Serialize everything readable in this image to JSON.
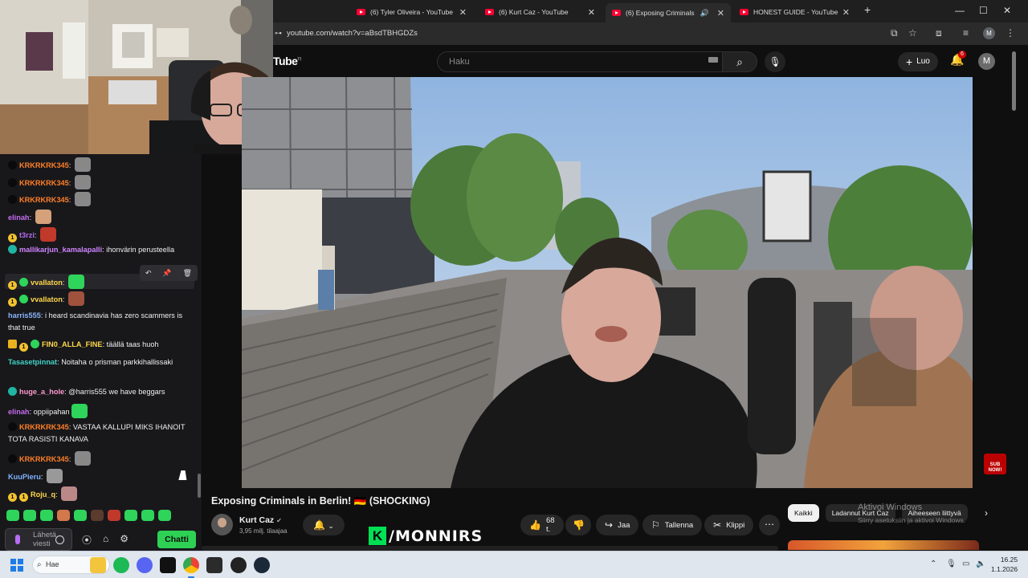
{
  "browser": {
    "tabs": [
      {
        "title": "(6) Tyler Oliveira - YouTube",
        "active": false
      },
      {
        "title": "(6) Kurt Caz - YouTube",
        "active": false
      },
      {
        "title": "(6) Exposing Criminals in Be",
        "active": true
      },
      {
        "title": "HONEST GUIDE - YouTube",
        "active": false
      }
    ],
    "new_tab": "+",
    "url": "youtube.com/watch?v=aBsdTBHGDZs",
    "profile_initial": "M"
  },
  "youtube": {
    "logo": "Tube",
    "region": "FI",
    "search_placeholder": "Haku",
    "create_label": "Luo",
    "notification_count": "6",
    "avatar_initial": "M",
    "video_title": "Exposing Criminals in Berlin! 🇩🇪 (SHOCKING)",
    "channel_name": "Kurt Caz",
    "subscribers": "3,95 milj. tilaajaa",
    "likes": "68 t.",
    "share_label": "Jaa",
    "save_label": "Tallenna",
    "clip_label": "Klippi",
    "chips": [
      "Kaikki",
      "Ladannut Kurt Caz",
      "Aiheeseen liittyvä"
    ],
    "sub_badge": "SUB NOW!"
  },
  "overlay": {
    "brand_letter": "K",
    "brand_text": "/MONNIRS",
    "windows_activate_title": "Aktivoi Windows",
    "windows_activate_sub": "Siirry asetuksiin ja aktivoi Windows."
  },
  "chat": {
    "messages": [
      {
        "user": "KRKRKRK345",
        "color": "#ff7f27",
        "badges": [
          "dark"
        ],
        "text": "",
        "emote": "#888"
      },
      {
        "user": "KRKRKRK345",
        "color": "#ff7f27",
        "badges": [
          "dark"
        ],
        "text": "",
        "emote": "#888"
      },
      {
        "user": "KRKRKRK345",
        "color": "#ff7f27",
        "badges": [
          "dark"
        ],
        "text": "",
        "emote": "#888"
      },
      {
        "user": "elinah",
        "color": "#c56bf0",
        "badges": [],
        "text": "",
        "emote": "#d4a17a"
      },
      {
        "user": "t3rzi",
        "color": "#b66bf0",
        "badges": [
          "gold"
        ],
        "text": "",
        "emote": "#c0392b"
      },
      {
        "user": "mallikarjun_kamalapalli",
        "color": "#d084ff",
        "badges": [
          "tea"
        ],
        "text": "ihonvärin perusteella",
        "emote": ""
      },
      {
        "user": "vvallaton",
        "color": "#ffd84a",
        "badges": [
          "gold",
          "green"
        ],
        "text": "",
        "emote": "#2fd45a"
      },
      {
        "user": "vvallaton",
        "color": "#ffd84a",
        "badges": [
          "gold",
          "green"
        ],
        "text": "",
        "emote": "#a0523d"
      },
      {
        "user": "harris555",
        "color": "#8bb4ff",
        "badges": [],
        "text": "i heard scandinavia has zero scammers is that true",
        "emote": ""
      },
      {
        "user": "FIN0_ALLA_FINE",
        "color": "#ffd84a",
        "badges": [
          "crown",
          "gold",
          "green"
        ],
        "text": "täällä taas huoh",
        "emote": ""
      },
      {
        "user": "Tasasetpinnat",
        "color": "#3fd3c5",
        "badges": [],
        "text": "Noitaha o prisman parkkihallissaki",
        "emote": ""
      },
      {
        "user": "huge_a_hole",
        "color": "#ff9acb",
        "badges": [
          "tea"
        ],
        "text": "@harris555 we have beggars",
        "emote": ""
      },
      {
        "user": "elinah",
        "color": "#c56bf0",
        "badges": [],
        "text": "oppiipahan",
        "emote": "#2fd45a"
      },
      {
        "user": "KRKRKRK345",
        "color": "#ff7f27",
        "badges": [
          "dark"
        ],
        "text": "VASTAA KALLUPI MIKS IHANOIT TOTA RASISTI KANAVA",
        "emote": ""
      },
      {
        "user": "KRKRKRK345",
        "color": "#ff7f27",
        "badges": [
          "dark"
        ],
        "text": "",
        "emote": "#888"
      },
      {
        "user": "KuuPieru",
        "color": "#7fb2ff",
        "badges": [],
        "text": "",
        "emote": "#999"
      },
      {
        "user": "Roju_q",
        "color": "#ffd84a",
        "badges": [
          "gold",
          "gold"
        ],
        "text": "",
        "emote": "#b88"
      }
    ],
    "input_placeholder": "Lähetä viesti",
    "send_label": "Chatti"
  },
  "taskbar": {
    "search_label": "Hae",
    "time": "16.25",
    "date": "1.1.2026"
  }
}
